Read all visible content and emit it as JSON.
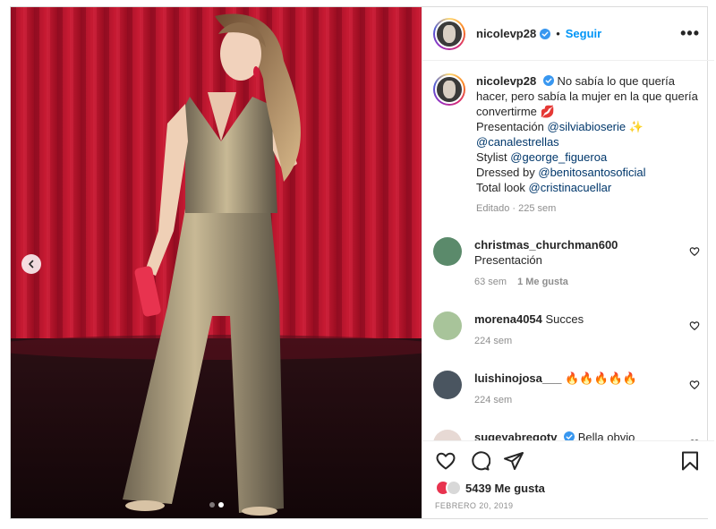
{
  "post": {
    "username": "nicolevp28",
    "dot": "•",
    "follow_label": "Seguir",
    "more_label": "•••"
  },
  "caption": {
    "username": "nicolevp28",
    "line1": "No sabía lo que quería hacer, pero sabía la mujer en la que quería convertirme",
    "emoji_lips": "💋",
    "presentation_prefix": "Presentación",
    "mention_presenter": "@silviabioserie",
    "emoji_sparkle": "✨",
    "mention_channel": "@canalestrellas",
    "stylist_prefix": "Stylist",
    "mention_stylist": "@george_figueroa",
    "dressed_prefix": "Dressed by",
    "mention_dressed": "@benitosantosoficial",
    "look_prefix": "Total look",
    "mention_look": "@cristinacuellar",
    "meta": "Editado · 225 sem"
  },
  "comments": [
    {
      "username": "christmas_churchman600",
      "text": "Presentación",
      "time": "63 sem",
      "likes": "1 Me gusta",
      "avatar_color": "#5b8a6b"
    },
    {
      "username": "morena4054",
      "text": "Succes",
      "time": "224 sem",
      "likes": "",
      "avatar_color": "#a8c49a"
    },
    {
      "username": "luishinojosa___",
      "text": "🔥🔥🔥🔥🔥",
      "time": "224 sem",
      "likes": "",
      "avatar_color": "#4a5560"
    },
    {
      "username": "sugeyabregotv",
      "text": "Bella obvio",
      "time": "",
      "likes": "",
      "avatar_color": "#e7d9d4"
    }
  ],
  "footer": {
    "likes_count": "5439",
    "likes_label": "Me gusta",
    "date": "FEBRERO 20, 2019"
  },
  "carousel": {
    "slides": 2,
    "active": 1
  },
  "colors": {
    "accent": "#0095f6",
    "verified": "#3897f0",
    "curtain": "#c6152d",
    "mention": "#00376b"
  },
  "icons": [
    "verified-badge-icon",
    "more-options-icon",
    "heart-icon",
    "comment-icon",
    "share-icon",
    "bookmark-icon",
    "chevron-left-icon"
  ]
}
